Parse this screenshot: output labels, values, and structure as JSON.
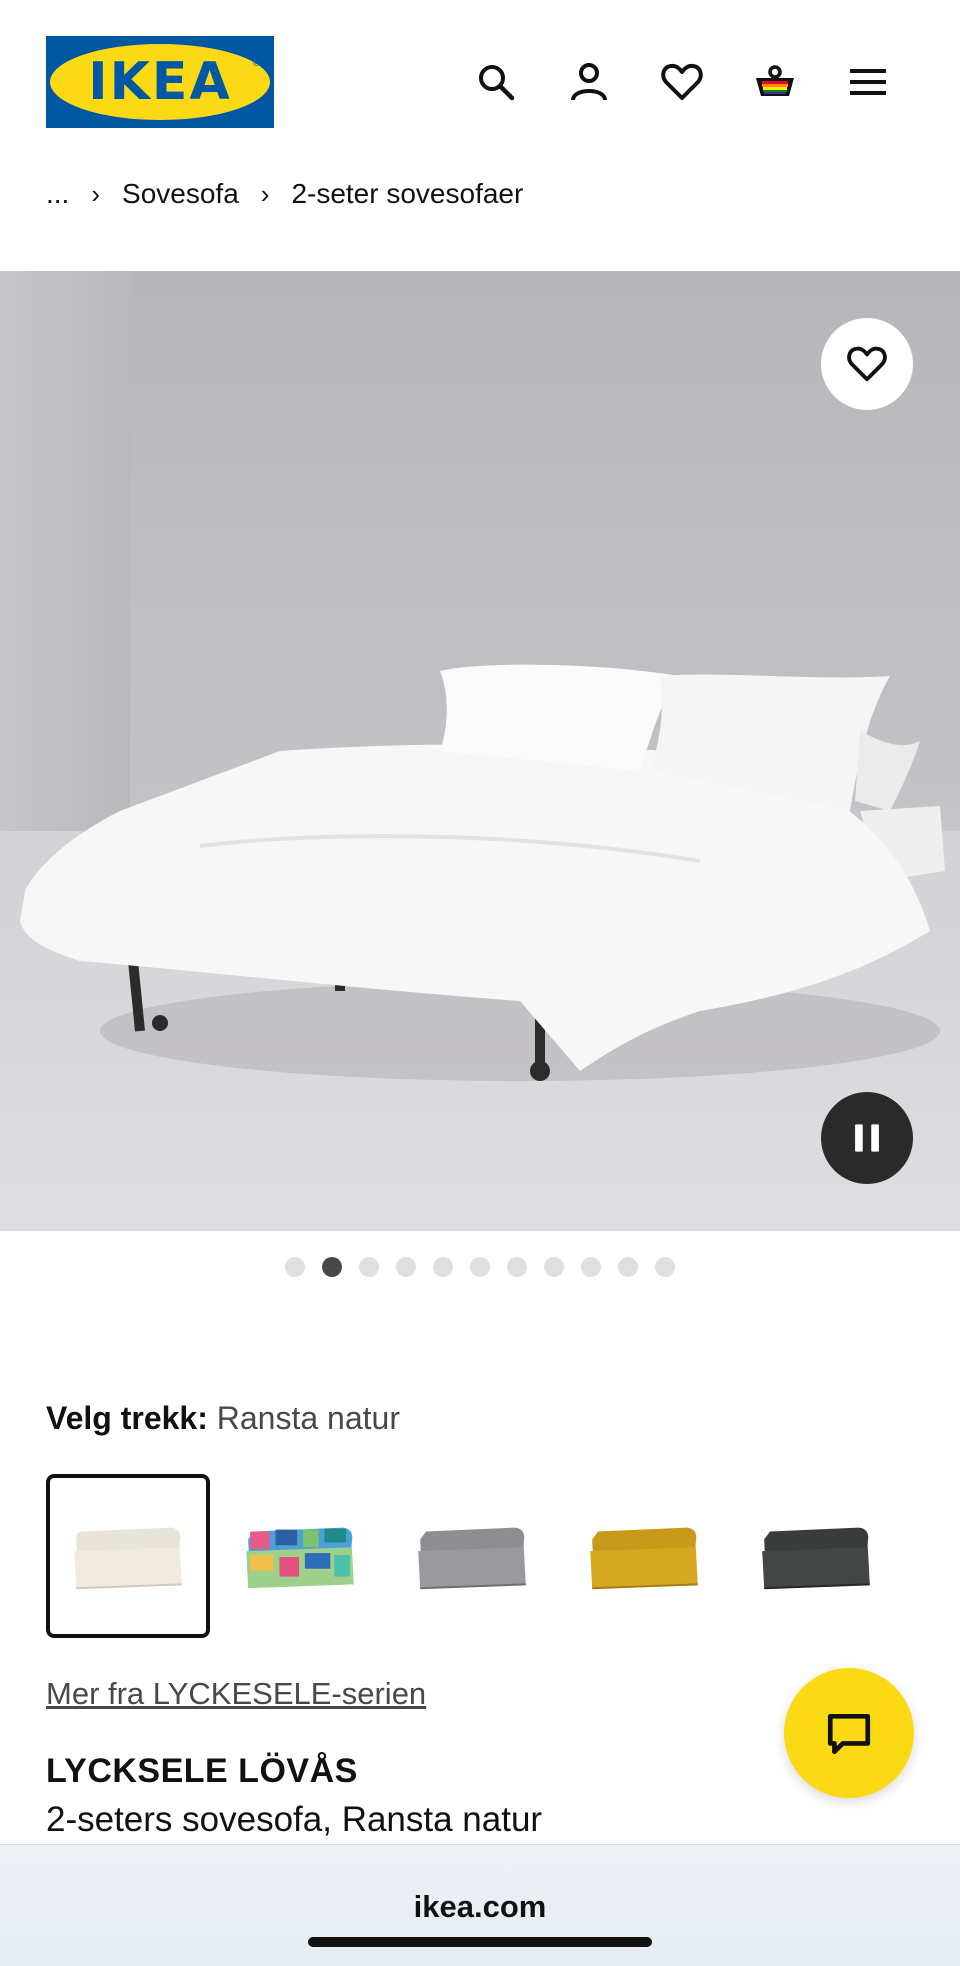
{
  "header": {
    "logo_text": "IKEA",
    "logo_reg": "®",
    "icons": [
      "search-icon",
      "account-icon",
      "heart-icon",
      "cart-icon",
      "menu-icon"
    ]
  },
  "breadcrumb": {
    "items": [
      "...",
      "Sovesofa",
      "2-seter sovesofaer"
    ]
  },
  "gallery": {
    "slide_count": 11,
    "active_index": 1,
    "icons": [
      "heart-icon",
      "pause-icon"
    ]
  },
  "selector": {
    "label": "Velg trekk:",
    "value": "Ransta natur",
    "swatches": [
      {
        "color": "#e9e4d8",
        "selected": true
      },
      {
        "color": "multicolor",
        "selected": false
      },
      {
        "color": "#8e8e92",
        "selected": false
      },
      {
        "color": "#d3a51b",
        "selected": false
      },
      {
        "color": "#3d403f",
        "selected": false
      }
    ]
  },
  "series_link": "Mer fra LYCKESELE-serien",
  "product": {
    "name": "LYCKSELE LÖVÅS",
    "description": "2-seters sovesofa, Ransta natur"
  },
  "chat": {
    "icon": "chat-icon"
  },
  "browser": {
    "url": "ikea.com"
  },
  "colors": {
    "brand_blue": "#0058a3",
    "brand_yellow": "#fbd914"
  }
}
